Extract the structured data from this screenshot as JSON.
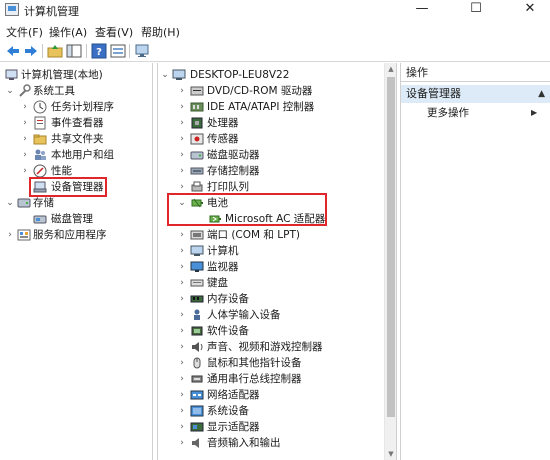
{
  "window": {
    "title": "计算机管理",
    "minimize": "—",
    "maximize": "☐",
    "close": "✕"
  },
  "menu": [
    "文件(F)",
    "操作(A)",
    "查看(V)",
    "帮助(H)"
  ],
  "left_tree": [
    {
      "label": "计算机管理(本地)",
      "expander": "",
      "icon": "computer-management-icon"
    },
    {
      "label": "系统工具",
      "expander": "⌄",
      "icon": "system-tools-icon"
    },
    {
      "label": "任务计划程序",
      "expander": "›",
      "icon": "task-scheduler-icon"
    },
    {
      "label": "事件查看器",
      "expander": "›",
      "icon": "event-viewer-icon"
    },
    {
      "label": "共享文件夹",
      "expander": "›",
      "icon": "shared-folders-icon"
    },
    {
      "label": "本地用户和组",
      "expander": "›",
      "icon": "local-users-icon"
    },
    {
      "label": "性能",
      "expander": "›",
      "icon": "performance-icon"
    },
    {
      "label": "设备管理器",
      "expander": "",
      "icon": "device-manager-icon"
    },
    {
      "label": "存储",
      "expander": "⌄",
      "icon": "storage-icon"
    },
    {
      "label": "磁盘管理",
      "expander": "",
      "icon": "disk-management-icon"
    },
    {
      "label": "服务和应用程序",
      "expander": "›",
      "icon": "services-apps-icon"
    }
  ],
  "device_tree": {
    "root": "DESKTOP-LEU8V22",
    "items": [
      {
        "label": "DVD/CD-ROM 驱动器",
        "expander": "›",
        "icon": "dvd-drive-icon"
      },
      {
        "label": "IDE ATA/ATAPI 控制器",
        "expander": "›",
        "icon": "ide-controller-icon"
      },
      {
        "label": "处理器",
        "expander": "›",
        "icon": "processor-icon"
      },
      {
        "label": "传感器",
        "expander": "›",
        "icon": "sensor-icon"
      },
      {
        "label": "磁盘驱动器",
        "expander": "›",
        "icon": "disk-drive-icon"
      },
      {
        "label": "存储控制器",
        "expander": "›",
        "icon": "storage-controller-icon"
      },
      {
        "label": "打印队列",
        "expander": "›",
        "icon": "print-queue-icon"
      },
      {
        "label": "电池",
        "expander": "⌄",
        "icon": "battery-icon"
      },
      {
        "label": "Microsoft AC 适配器",
        "expander": "",
        "icon": "ac-adapter-icon",
        "child": true
      },
      {
        "label": "端口 (COM 和 LPT)",
        "expander": "›",
        "icon": "port-icon"
      },
      {
        "label": "计算机",
        "expander": "›",
        "icon": "computer-icon"
      },
      {
        "label": "监视器",
        "expander": "›",
        "icon": "monitor-icon"
      },
      {
        "label": "键盘",
        "expander": "›",
        "icon": "keyboard-icon"
      },
      {
        "label": "内存设备",
        "expander": "›",
        "icon": "memory-device-icon"
      },
      {
        "label": "人体学输入设备",
        "expander": "›",
        "icon": "hid-icon"
      },
      {
        "label": "软件设备",
        "expander": "›",
        "icon": "software-device-icon"
      },
      {
        "label": "声音、视频和游戏控制器",
        "expander": "›",
        "icon": "sound-video-icon"
      },
      {
        "label": "鼠标和其他指针设备",
        "expander": "›",
        "icon": "mouse-icon"
      },
      {
        "label": "通用串行总线控制器",
        "expander": "›",
        "icon": "usb-controller-icon"
      },
      {
        "label": "网络适配器",
        "expander": "›",
        "icon": "network-adapter-icon"
      },
      {
        "label": "系统设备",
        "expander": "›",
        "icon": "system-device-icon"
      },
      {
        "label": "显示适配器",
        "expander": "›",
        "icon": "display-adapter-icon"
      },
      {
        "label": "音频输入和输出",
        "expander": "›",
        "icon": "audio-io-icon"
      }
    ]
  },
  "actions": {
    "header": "操作",
    "section": "设备管理器",
    "section_caret": "▲",
    "item": "更多操作",
    "item_arrow": "▶"
  },
  "colors": {
    "highlight_box": "#e0252b",
    "section_bg": "#dcebf7"
  }
}
